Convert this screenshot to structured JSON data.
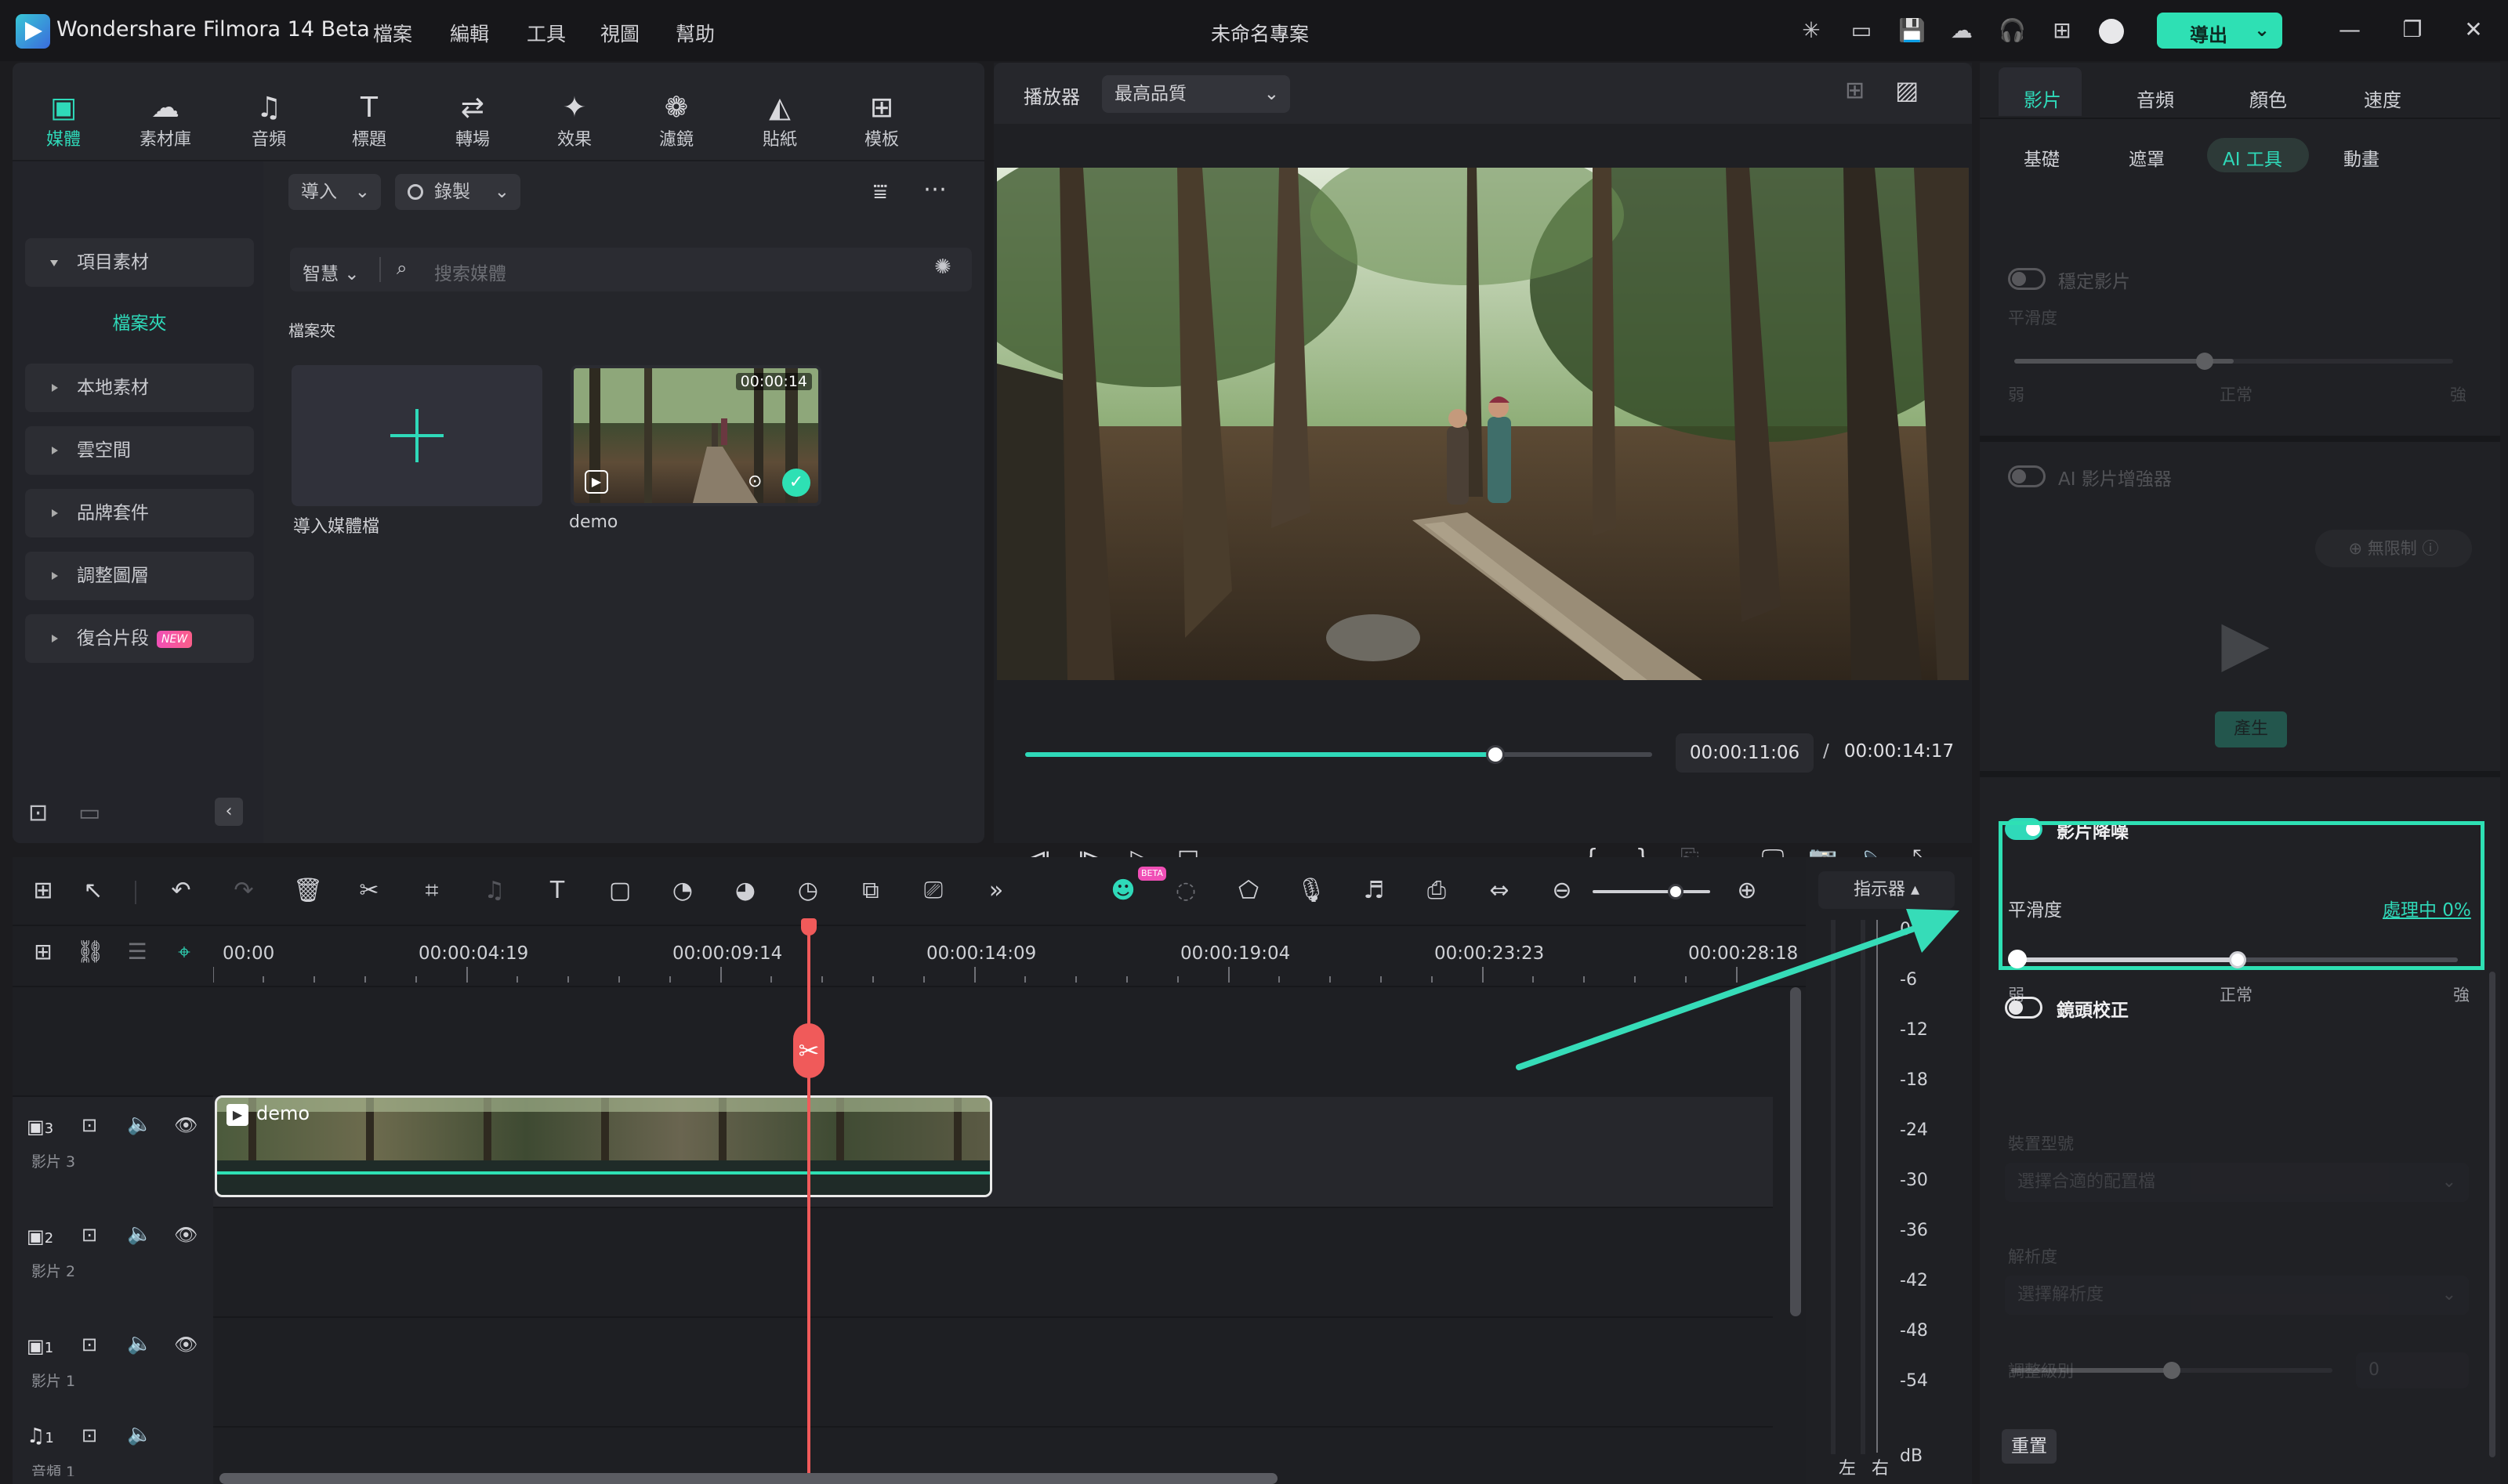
{
  "app": {
    "name": "Wondershare Filmora 14 Beta",
    "menu": [
      "檔案",
      "編輯",
      "工具",
      "視圖",
      "幫助"
    ],
    "project_title": "未命名專案",
    "export_label": "導出"
  },
  "media_tabs": [
    {
      "label": "媒體",
      "icon": "media-icon"
    },
    {
      "label": "素材庫",
      "icon": "library-icon"
    },
    {
      "label": "音頻",
      "icon": "music-note-icon"
    },
    {
      "label": "標題",
      "icon": "title-t-icon"
    },
    {
      "label": "轉場",
      "icon": "transition-icon"
    },
    {
      "label": "效果",
      "icon": "effects-star-icon"
    },
    {
      "label": "濾鏡",
      "icon": "filter-icon"
    },
    {
      "label": "貼紙",
      "icon": "sticker-icon"
    },
    {
      "label": "模板",
      "icon": "template-icon"
    }
  ],
  "sidebar": {
    "items": [
      "項目素材",
      "本地素材",
      "雲空間",
      "品牌套件",
      "調整圖層",
      "復合片段"
    ],
    "folder": "檔案夾",
    "new_badge": "NEW"
  },
  "media": {
    "import_label": "導入",
    "record_label": "錄製",
    "smart_label": "智慧",
    "search_placeholder": "搜索媒體",
    "folder_heading": "檔案夾",
    "import_tile_label": "導入媒體檔",
    "clip_name": "demo",
    "clip_duration": "00:00:14"
  },
  "player": {
    "label": "播放器",
    "quality": "最高品質",
    "current_time": "00:00:11:06",
    "separator": "/",
    "total_time": "00:00:14:17",
    "progress_fraction": 0.75
  },
  "properties": {
    "tabs": [
      "影片",
      "音頻",
      "顏色",
      "速度"
    ],
    "subtabs": [
      "基礎",
      "遮罩",
      "AI 工具",
      "動畫"
    ],
    "stabilize_label": "穩定影片",
    "smoothness_top_label": "平滑度",
    "weak": "弱",
    "normal": "正常",
    "strong": "強",
    "ai_enhancer_label": "AI 影片增強器",
    "unlimited_label": "無限制",
    "generate_label": "產生",
    "denoise_label": "影片降噪",
    "smoothness_label": "平滑度",
    "processing_label": "處理中 0%",
    "lens_correction_label": "鏡頭校正",
    "device_model_label": "裝置型號",
    "device_model_placeholder": "選擇合適的配置檔",
    "resolution_label": "解析度",
    "resolution_placeholder": "選擇解析度",
    "adjust_level_label": "調整級別",
    "adjust_level_value": "0",
    "reset_label": "重置",
    "denoise_smoothness_fraction": 0.5
  },
  "timeline": {
    "indicator_label": "指示器",
    "ruler": [
      "00:00",
      "00:00:04:19",
      "00:00:09:14",
      "00:00:14:09",
      "00:00:19:04",
      "00:00:23:23",
      "00:00:28:18"
    ],
    "tracks": [
      {
        "num": "3",
        "name": "影片 3"
      },
      {
        "num": "2",
        "name": "影片 2"
      },
      {
        "num": "1",
        "name": "影片 1"
      },
      {
        "num": "1",
        "name": "音頻 1"
      }
    ],
    "clip_name": "demo",
    "meter": [
      "0",
      "-6",
      "-12",
      "-18",
      "-24",
      "-30",
      "-36",
      "-42",
      "-48",
      "-54",
      "dB"
    ],
    "meter_left": "左",
    "meter_right": "右",
    "beta_badge": "BETA"
  }
}
